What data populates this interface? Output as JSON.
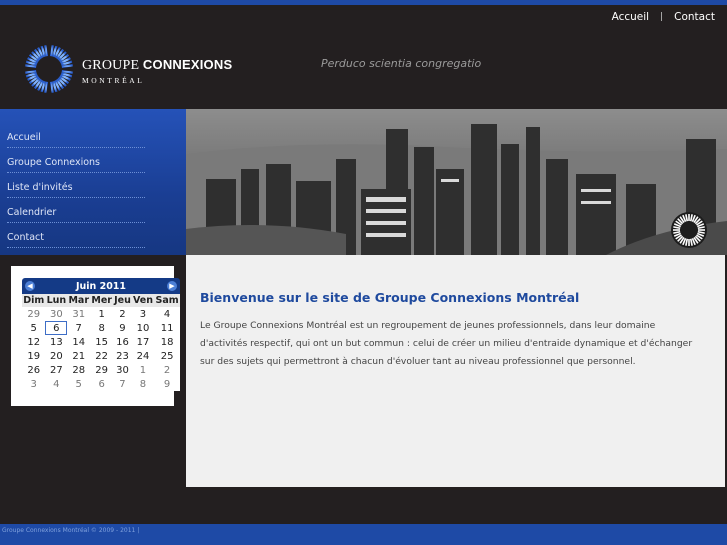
{
  "top_links": {
    "home": "Accueil",
    "separator": "|",
    "contact": "Contact"
  },
  "logo": {
    "line1_regular": "GROUPE",
    "line1_bold": "CONNEXIONS",
    "line2": "MONTRÉAL"
  },
  "tagline": "Perduco scientia congregatio",
  "nav": {
    "items": [
      {
        "label": "Accueil"
      },
      {
        "label": "Groupe Connexions"
      },
      {
        "label": "Liste d'invités"
      },
      {
        "label": "Calendrier"
      },
      {
        "label": "Contact"
      }
    ]
  },
  "content": {
    "title": "Bienvenue sur le site de Groupe Connexions Montréal",
    "body": "Le Groupe Connexions Montréal est un regroupement de jeunes professionnels, dans leur domaine d'activités respectif, qui ont un but commun : celui de créer un milieu d'entraide dynamique et d'échanger sur des sujets qui permettront à chacun d'évoluer tant au niveau professionnel que personnel."
  },
  "calendar": {
    "month_label": "Juin 2011",
    "prev_icon": "chevron-left-icon",
    "next_icon": "chevron-right-icon",
    "weekdays": [
      "Dim",
      "Lun",
      "Mar",
      "Mer",
      "Jeu",
      "Ven",
      "Sam"
    ],
    "weeks": [
      [
        {
          "d": "29",
          "other": true
        },
        {
          "d": "30",
          "other": true
        },
        {
          "d": "31",
          "other": true
        },
        {
          "d": "1"
        },
        {
          "d": "2"
        },
        {
          "d": "3"
        },
        {
          "d": "4"
        }
      ],
      [
        {
          "d": "5"
        },
        {
          "d": "6",
          "today": true
        },
        {
          "d": "7"
        },
        {
          "d": "8"
        },
        {
          "d": "9"
        },
        {
          "d": "10"
        },
        {
          "d": "11"
        }
      ],
      [
        {
          "d": "12"
        },
        {
          "d": "13"
        },
        {
          "d": "14"
        },
        {
          "d": "15"
        },
        {
          "d": "16"
        },
        {
          "d": "17"
        },
        {
          "d": "18"
        }
      ],
      [
        {
          "d": "19"
        },
        {
          "d": "20"
        },
        {
          "d": "21"
        },
        {
          "d": "22"
        },
        {
          "d": "23"
        },
        {
          "d": "24"
        },
        {
          "d": "25"
        }
      ],
      [
        {
          "d": "26"
        },
        {
          "d": "27"
        },
        {
          "d": "28"
        },
        {
          "d": "29"
        },
        {
          "d": "30"
        },
        {
          "d": "1",
          "other": true
        },
        {
          "d": "2",
          "other": true
        }
      ],
      [
        {
          "d": "3",
          "other": true
        },
        {
          "d": "4",
          "other": true
        },
        {
          "d": "5",
          "other": true
        },
        {
          "d": "6",
          "other": true
        },
        {
          "d": "7",
          "other": true
        },
        {
          "d": "8",
          "other": true
        },
        {
          "d": "9",
          "other": true
        }
      ]
    ]
  },
  "footer": {
    "text": "Groupe Connexions Montréal © 2009 - 2011 |"
  },
  "colors": {
    "accent": "#1e4aa6",
    "title": "#1f4a9e",
    "background": "#231f20"
  }
}
